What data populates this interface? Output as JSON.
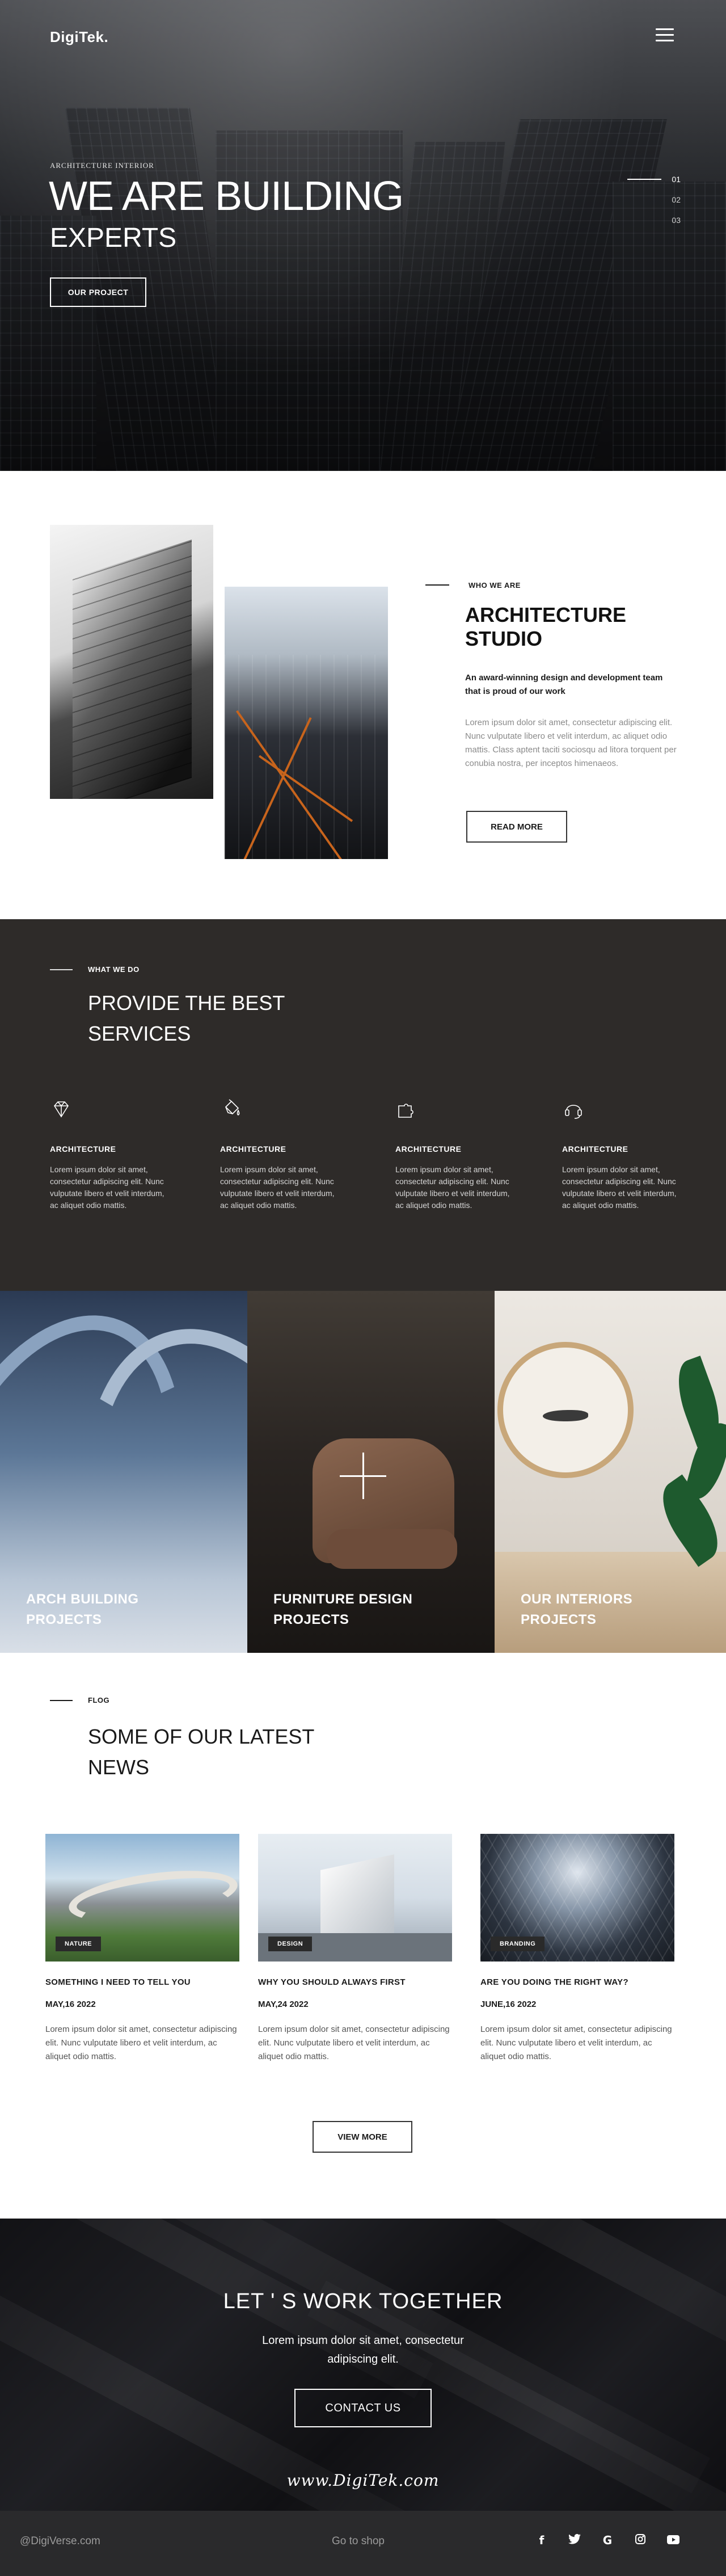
{
  "header": {
    "logo": "DigiTek."
  },
  "hero": {
    "kicker": "ARCHITECTURE INTERIOR",
    "title": "WE ARE BUILDING",
    "subtitle": "EXPERTS",
    "button": "OUR PROJECT",
    "slides": [
      "01",
      "02",
      "03"
    ],
    "active_slide": "01"
  },
  "about": {
    "kicker": "WHO WE ARE",
    "title_line1": "ARCHITECTURE",
    "title_line2": "STUDIO",
    "lead": "An award-winning design and development team that is proud of our work",
    "body": "Lorem ipsum dolor sit amet, consectetur adipiscing elit. Nunc vulputate libero et velit interdum, ac aliquet odio mattis. Class aptent taciti sociosqu ad litora torquent per conubia nostra, per inceptos himenaeos.",
    "button": "READ MORE"
  },
  "services": {
    "kicker": "WHAT WE DO",
    "title_line1": "PROVIDE THE BEST",
    "title_line2": "SERVICES",
    "items": [
      {
        "icon": "diamond-icon",
        "title": "ARCHITECTURE",
        "text": "Lorem ipsum dolor sit amet, consectetur adipiscing elit. Nunc vulputate libero et velit interdum, ac aliquet odio mattis."
      },
      {
        "icon": "paint-bucket-icon",
        "title": "ARCHITECTURE",
        "text": "Lorem ipsum dolor sit amet, consectetur adipiscing elit. Nunc vulputate libero et velit interdum, ac aliquet odio mattis."
      },
      {
        "icon": "puzzle-icon",
        "title": "ARCHITECTURE",
        "text": "Lorem ipsum dolor sit amet, consectetur adipiscing elit. Nunc vulputate libero et velit interdum, ac aliquet odio mattis."
      },
      {
        "icon": "headset-icon",
        "title": "ARCHITECTURE",
        "text": "Lorem ipsum dolor sit amet, consectetur adipiscing elit. Nunc vulputate libero et velit interdum, ac aliquet odio mattis."
      }
    ]
  },
  "projects": [
    {
      "line1": "ARCH BUILDING",
      "line2": "PROJECTS"
    },
    {
      "line1": "FURNITURE DESIGN",
      "line2": "PROJECTS"
    },
    {
      "line1": "OUR INTERIORS",
      "line2": "PROJECTS"
    }
  ],
  "news": {
    "kicker": "FLOG",
    "title_line1": "SOME OF OUR LATEST",
    "title_line2": "NEWS",
    "posts": [
      {
        "badge": "NATURE",
        "title": "SOMETHING I NEED TO TELL YOU",
        "date": "MAY,16 2022",
        "text": "Lorem ipsum dolor sit amet, consectetur adipiscing elit. Nunc vulputate libero et velit interdum, ac aliquet odio mattis."
      },
      {
        "badge": "DESIGN",
        "title": "WHY YOU SHOULD ALWAYS FIRST",
        "date": "MAY,24 2022",
        "text": "Lorem ipsum dolor sit amet, consectetur adipiscing elit. Nunc vulputate libero et velit interdum, ac aliquet odio mattis."
      },
      {
        "badge": "BRANDING",
        "title": "ARE YOU DOING THE RIGHT WAY?",
        "date": "JUNE,16 2022",
        "text": "Lorem ipsum dolor sit amet, consectetur adipiscing elit. Nunc vulputate libero et velit interdum, ac aliquet odio mattis."
      }
    ],
    "button": "VIEW MORE"
  },
  "cta": {
    "title": "LET ' S WORK TOGETHER",
    "text": "Lorem ipsum dolor sit amet, consectetur adipiscing elit.",
    "button": "CONTACT US",
    "signature": "www.DigiTek.com"
  },
  "footer": {
    "handle": "@DigiVerse.com",
    "shop": "Go to shop",
    "social": [
      {
        "icon": "facebook-icon",
        "glyph": "f"
      },
      {
        "icon": "twitter-icon",
        "glyph": "t"
      },
      {
        "icon": "google-icon",
        "glyph": "G"
      },
      {
        "icon": "instagram-icon",
        "glyph": "◎"
      },
      {
        "icon": "youtube-icon",
        "glyph": "▶"
      }
    ]
  }
}
